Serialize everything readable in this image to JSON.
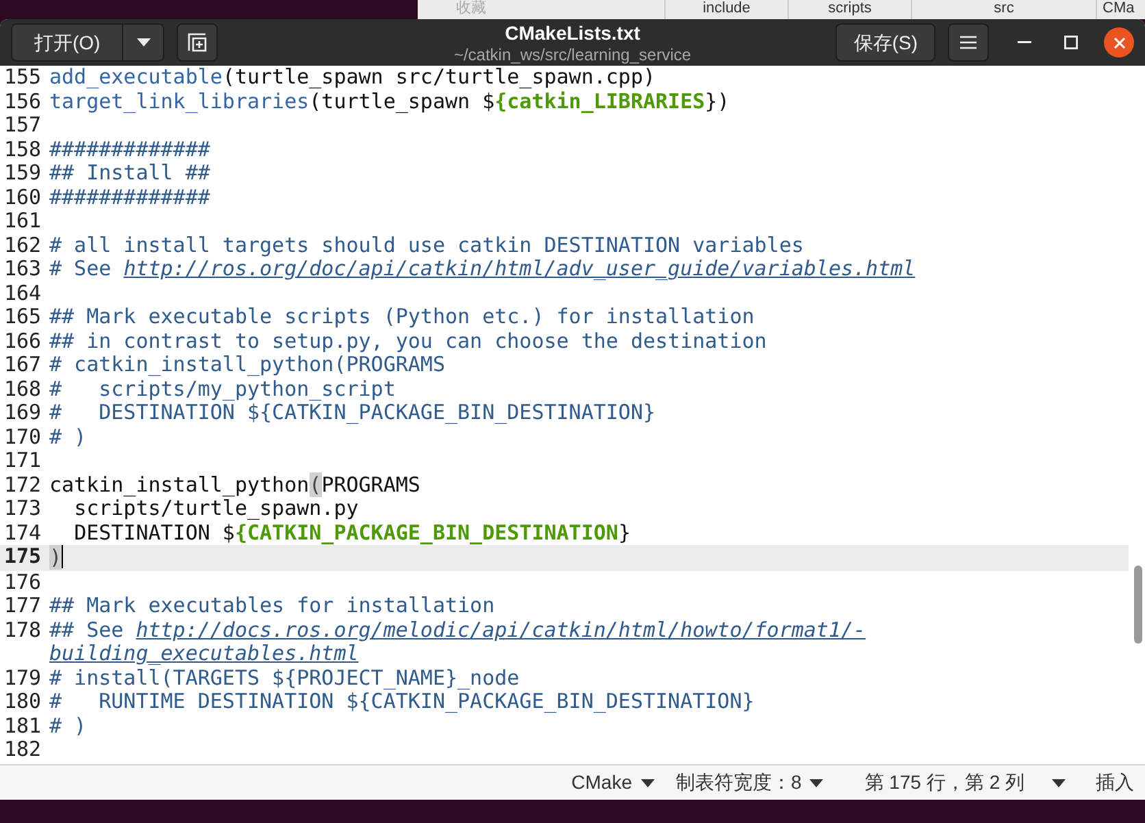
{
  "background_window": {
    "tabs": [
      {
        "label": "收藏",
        "faded": true
      },
      {
        "label": "include",
        "faded": false
      },
      {
        "label": "scripts",
        "faded": false
      },
      {
        "label": "src",
        "faded": false
      },
      {
        "label": "CMa",
        "faded": false
      }
    ]
  },
  "header": {
    "open_button": "打开(O)",
    "title": "CMakeLists.txt",
    "subtitle": "~/catkin_ws/src/learning_service",
    "save_button": "保存(S)"
  },
  "editor": {
    "lines": [
      {
        "number": "155",
        "current": false,
        "segments": [
          {
            "kind": "function",
            "text": "add_executable"
          },
          {
            "kind": "plain",
            "text": "(turtle_spawn src/turtle_spawn.cpp)"
          }
        ]
      },
      {
        "number": "156",
        "current": false,
        "segments": [
          {
            "kind": "function",
            "text": "target_link_libraries"
          },
          {
            "kind": "plain",
            "text": "(turtle_spawn $"
          },
          {
            "kind": "variable",
            "text": "{catkin_LIBRARIES"
          },
          {
            "kind": "plain",
            "text": "})"
          }
        ]
      },
      {
        "number": "157",
        "current": false
      },
      {
        "number": "158",
        "current": false,
        "segments": [
          {
            "kind": "comment",
            "text": "#############"
          }
        ]
      },
      {
        "number": "159",
        "current": false,
        "segments": [
          {
            "kind": "comment",
            "text": "## Install ##"
          }
        ]
      },
      {
        "number": "160",
        "current": false,
        "segments": [
          {
            "kind": "comment",
            "text": "#############"
          }
        ]
      },
      {
        "number": "161",
        "current": false
      },
      {
        "number": "162",
        "current": false,
        "segments": [
          {
            "kind": "comment",
            "text": "# all install targets should use catkin DESTINATION variables"
          }
        ]
      },
      {
        "number": "163",
        "current": false,
        "segments": [
          {
            "kind": "comment",
            "text": "# See "
          },
          {
            "kind": "link",
            "text": "http://ros.org/doc/api/catkin/html/adv_user_guide/variables.html"
          }
        ]
      },
      {
        "number": "164",
        "current": false
      },
      {
        "number": "165",
        "current": false,
        "segments": [
          {
            "kind": "comment",
            "text": "## Mark executable scripts (Python etc.) for installation"
          }
        ]
      },
      {
        "number": "166",
        "current": false,
        "segments": [
          {
            "kind": "comment",
            "text": "## in contrast to setup.py, you can choose the destination"
          }
        ]
      },
      {
        "number": "167",
        "current": false,
        "segments": [
          {
            "kind": "comment",
            "text": "# catkin_install_python(PROGRAMS"
          }
        ]
      },
      {
        "number": "168",
        "current": false,
        "segments": [
          {
            "kind": "comment",
            "text": "#   scripts/my_python_script"
          }
        ]
      },
      {
        "number": "169",
        "current": false,
        "segments": [
          {
            "kind": "comment",
            "text": "#   DESTINATION ${CATKIN_PACKAGE_BIN_DESTINATION}"
          }
        ]
      },
      {
        "number": "170",
        "current": false,
        "segments": [
          {
            "kind": "comment",
            "text": "# )"
          }
        ]
      },
      {
        "number": "171",
        "current": false
      },
      {
        "number": "172",
        "current": false,
        "segments": [
          {
            "kind": "plain",
            "text": "catkin_install_python"
          },
          {
            "kind": "bracket_match",
            "text": "("
          },
          {
            "kind": "plain",
            "text": "PROGRAMS"
          }
        ]
      },
      {
        "number": "173",
        "current": false,
        "segments": [
          {
            "kind": "plain",
            "text": "  scripts/turtle_spawn.py"
          }
        ]
      },
      {
        "number": "174",
        "current": false,
        "segments": [
          {
            "kind": "plain",
            "text": "  DESTINATION $"
          },
          {
            "kind": "variable",
            "text": "{CATKIN_PACKAGE_BIN_DESTINATION"
          },
          {
            "kind": "plain",
            "text": "}"
          }
        ]
      },
      {
        "number": "175",
        "current": true,
        "segments": [
          {
            "kind": "bracket_match",
            "text": ")"
          }
        ]
      },
      {
        "number": "176",
        "current": false
      },
      {
        "number": "177",
        "current": false,
        "segments": [
          {
            "kind": "comment",
            "text": "## Mark executables for installation"
          }
        ]
      },
      {
        "number": "178",
        "current": false,
        "segments": [
          {
            "kind": "comment",
            "text": "## See "
          },
          {
            "kind": "link",
            "text": "http://docs.ros.org/melodic/api/catkin/html/howto/format1/-"
          },
          {
            "kind": "link",
            "text": "building_executables.html",
            "wrapped": true
          }
        ]
      },
      {
        "number": "179",
        "current": false,
        "segments": [
          {
            "kind": "comment",
            "text": "# install(TARGETS ${PROJECT_NAME}_node"
          }
        ]
      },
      {
        "number": "180",
        "current": false,
        "segments": [
          {
            "kind": "comment",
            "text": "#   RUNTIME DESTINATION ${CATKIN_PACKAGE_BIN_DESTINATION}"
          }
        ]
      },
      {
        "number": "181",
        "current": false,
        "segments": [
          {
            "kind": "comment",
            "text": "# )"
          }
        ]
      },
      {
        "number": "182",
        "current": false
      }
    ]
  },
  "status_bar": {
    "language": "CMake",
    "tab_width": "制表符宽度：8",
    "position": "第 175 行，第 2 列",
    "mode": "插入"
  }
}
